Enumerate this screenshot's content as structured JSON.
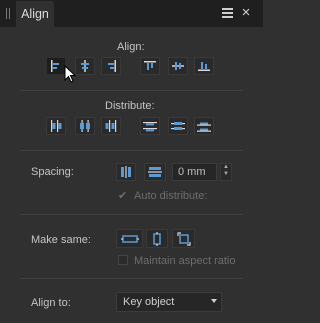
{
  "panel": {
    "tab_label": "Align",
    "menu_icon": "hamburger-menu-icon",
    "close_icon": "close-icon",
    "close_glyph": "×"
  },
  "align": {
    "label": "Align:",
    "buttons": [
      {
        "name": "align-left",
        "active": true
      },
      {
        "name": "align-center-horizontal"
      },
      {
        "name": "align-right"
      },
      {
        "name": "align-top"
      },
      {
        "name": "align-center-vertical"
      },
      {
        "name": "align-bottom"
      }
    ]
  },
  "distribute": {
    "label": "Distribute:",
    "buttons": [
      {
        "name": "distribute-left"
      },
      {
        "name": "distribute-center-horizontal"
      },
      {
        "name": "distribute-right"
      },
      {
        "name": "distribute-top"
      },
      {
        "name": "distribute-center-vertical"
      },
      {
        "name": "distribute-bottom"
      }
    ]
  },
  "spacing": {
    "label": "Spacing:",
    "value": "0 mm",
    "auto_distribute_label": "Auto distribute:",
    "auto_distribute_checked": true
  },
  "make_same": {
    "label": "Make same:",
    "maintain_aspect_label": "Maintain aspect ratio",
    "maintain_aspect_checked": false
  },
  "align_to": {
    "label": "Align to:",
    "selected": "Key object"
  },
  "colors": {
    "panel_bg": "#303030",
    "header_bg": "#1f1f1f",
    "icon_blue": "#5b9bd5",
    "icon_light": "#d8d8d8"
  }
}
